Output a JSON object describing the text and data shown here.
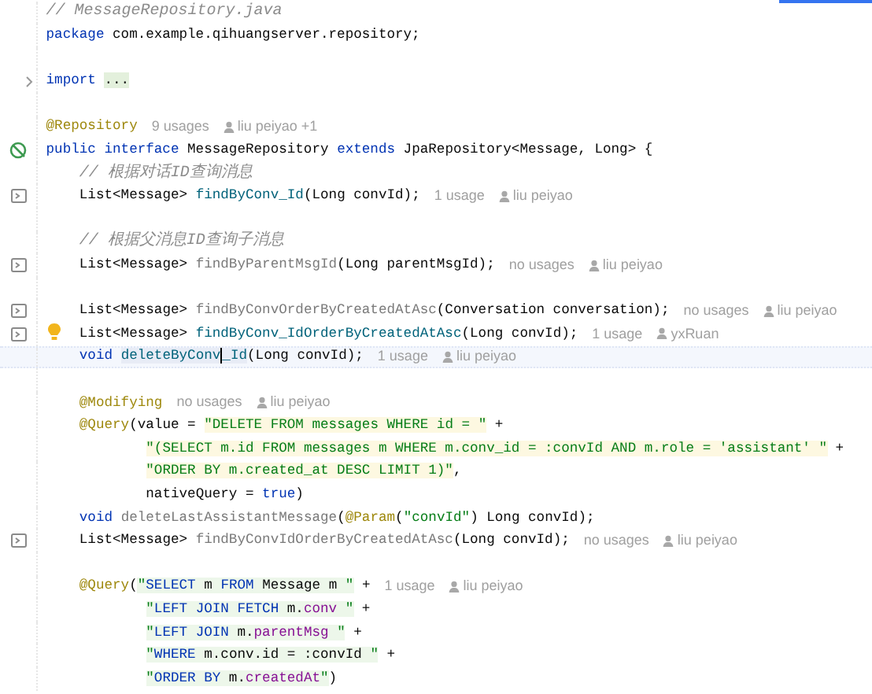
{
  "editor": {
    "lines": [
      {
        "current": false,
        "code": [
          {
            "t": "// MessageRepository.java",
            "kind": "comment"
          }
        ]
      },
      {
        "current": false,
        "code": [
          {
            "t": "package",
            "kind": "kw"
          },
          {
            "t": " com.example.qihuangserver.repository;",
            "kind": "plain"
          }
        ]
      },
      {
        "current": false
      },
      {
        "current": false,
        "gutter": {
          "kind": "fold"
        },
        "code": [
          {
            "t": "import ",
            "kind": "kw"
          },
          {
            "t": "...",
            "kind": "plain",
            "folded": true
          }
        ]
      },
      {
        "current": false
      },
      {
        "current": false,
        "code": [
          {
            "t": "@Repository",
            "kind": "ann"
          }
        ],
        "hints": [
          {
            "kind": "usages",
            "text": "9 usages"
          },
          {
            "kind": "author",
            "text": "liu peiyao +1"
          }
        ]
      },
      {
        "current": false,
        "gutter": {
          "kind": "implemented"
        },
        "code": [
          {
            "t": "public interface",
            "kind": "kw"
          },
          {
            "t": " MessageRepository ",
            "kind": "plain"
          },
          {
            "t": "extends",
            "kind": "kw"
          },
          {
            "t": " JpaRepository<Message, Long> {",
            "kind": "plain"
          }
        ]
      },
      {
        "current": false,
        "code": [
          {
            "t": "    // 根据对话ID查询消息",
            "kind": "comment"
          }
        ]
      },
      {
        "current": false,
        "gutter": {
          "kind": "method"
        },
        "code": [
          {
            "t": "    List<Message> ",
            "kind": "plain"
          },
          {
            "t": "findByConv_Id",
            "kind": "decl"
          },
          {
            "t": "(Long convId);",
            "kind": "plain"
          }
        ],
        "hints": [
          {
            "kind": "usages",
            "text": "1 usage"
          },
          {
            "kind": "author",
            "text": "liu peiyao"
          }
        ]
      },
      {
        "current": false
      },
      {
        "current": false,
        "code": [
          {
            "t": "    // 根据父消息ID查询子消息",
            "kind": "comment"
          }
        ]
      },
      {
        "current": false,
        "gutter": {
          "kind": "method"
        },
        "code": [
          {
            "t": "    List<Message> ",
            "kind": "plain"
          },
          {
            "t": "findByParentMsgId",
            "kind": "unused"
          },
          {
            "t": "(Long parentMsgId);",
            "kind": "plain"
          }
        ],
        "hints": [
          {
            "kind": "usages",
            "text": "no usages"
          },
          {
            "kind": "author",
            "text": "liu peiyao"
          }
        ]
      },
      {
        "current": false
      },
      {
        "current": false,
        "gutter": {
          "kind": "method"
        },
        "code": [
          {
            "t": "    List<Message> ",
            "kind": "plain"
          },
          {
            "t": "findByConvOrderByCreatedAtAsc",
            "kind": "unused"
          },
          {
            "t": "(Conversation conversation);",
            "kind": "plain"
          }
        ],
        "hints": [
          {
            "kind": "usages",
            "text": "no usages"
          },
          {
            "kind": "author",
            "text": "liu peiyao"
          }
        ]
      },
      {
        "current": false,
        "gutter": {
          "kind": "method"
        },
        "bulb": true,
        "code": [
          {
            "t": "    List<Message> ",
            "kind": "plain"
          },
          {
            "t": "findByConv_IdOrderByCreatedAtAsc",
            "kind": "decl"
          },
          {
            "t": "(Long convId);",
            "kind": "plain"
          }
        ],
        "hints": [
          {
            "kind": "usages",
            "text": "1 usage"
          },
          {
            "kind": "author",
            "text": "yxRuan"
          }
        ]
      },
      {
        "current": true,
        "code": [
          {
            "t": "    void ",
            "kind": "kw"
          },
          {
            "t": "deleteByConv",
            "kind": "decl",
            "usage_highlight": true,
            "caret": true
          },
          {
            "t": "_Id",
            "kind": "decl",
            "usage_highlight": true
          },
          {
            "t": "(Long convId);",
            "kind": "plain"
          }
        ],
        "hints": [
          {
            "kind": "usages",
            "text": "1 usage"
          },
          {
            "kind": "author",
            "text": "liu peiyao"
          }
        ]
      },
      {
        "current": false
      },
      {
        "current": false,
        "code": [
          {
            "t": "    @Modifying",
            "kind": "ann"
          }
        ],
        "hints": [
          {
            "kind": "usages",
            "text": "no usages"
          },
          {
            "kind": "author",
            "text": "liu peiyao"
          }
        ]
      },
      {
        "current": false,
        "code": [
          {
            "t": "    @Query",
            "kind": "ann"
          },
          {
            "t": "(value = ",
            "kind": "plain"
          },
          {
            "t": "\"DELETE FROM messages WHERE id = \"",
            "kind": "str",
            "sql": true
          },
          {
            "t": " +",
            "kind": "plain"
          }
        ]
      },
      {
        "current": false,
        "code": [
          {
            "t": "            \"(SELECT m.id FROM messages m WHERE m.conv_id = :convId AND m.role = 'assistant' \"",
            "kind": "str",
            "sql": true
          },
          {
            "t": " +",
            "kind": "plain"
          }
        ]
      },
      {
        "current": false,
        "code": [
          {
            "t": "            \"ORDER BY m.created_at DESC LIMIT 1)\"",
            "kind": "str",
            "sql": true
          },
          {
            "t": ",",
            "kind": "plain"
          }
        ]
      },
      {
        "current": false,
        "code": [
          {
            "t": "            nativeQuery = ",
            "kind": "plain"
          },
          {
            "t": "true",
            "kind": "kw"
          },
          {
            "t": ")",
            "kind": "plain"
          }
        ]
      },
      {
        "current": false,
        "code": [
          {
            "t": "    void ",
            "kind": "kw"
          },
          {
            "t": "deleteLastAssistantMessage",
            "kind": "unused"
          },
          {
            "t": "(",
            "kind": "plain"
          },
          {
            "t": "@Param",
            "kind": "ann"
          },
          {
            "t": "(",
            "kind": "plain"
          },
          {
            "t": "\"convId\"",
            "kind": "str"
          },
          {
            "t": ") Long convId);",
            "kind": "plain"
          }
        ]
      },
      {
        "current": false,
        "gutter": {
          "kind": "method"
        },
        "code": [
          {
            "t": "    List<Message> ",
            "kind": "plain"
          },
          {
            "t": "findByConvIdOrderByCreatedAtAsc",
            "kind": "unused"
          },
          {
            "t": "(Long convId);",
            "kind": "plain"
          }
        ],
        "hints": [
          {
            "kind": "usages",
            "text": "no usages"
          },
          {
            "kind": "author",
            "text": "liu peiyao"
          }
        ]
      },
      {
        "current": false
      },
      {
        "current": false,
        "code": [
          {
            "t": "    @Query",
            "kind": "ann"
          },
          {
            "t": "(",
            "kind": "plain"
          },
          {
            "t": "\"",
            "kind": "str",
            "jpql": true
          },
          {
            "t": "SELECT",
            "kind": "kw",
            "jpql": true
          },
          {
            "t": " m ",
            "kind": "plain",
            "jpql": true
          },
          {
            "t": "FROM",
            "kind": "kw",
            "jpql": true
          },
          {
            "t": " Message m ",
            "kind": "plain",
            "jpql": true
          },
          {
            "t": "\"",
            "kind": "str",
            "jpql": true
          },
          {
            "t": " +",
            "kind": "plain"
          }
        ],
        "hints": [
          {
            "kind": "usages",
            "text": "1 usage"
          },
          {
            "kind": "author",
            "text": "liu peiyao"
          }
        ]
      },
      {
        "current": false,
        "code": [
          {
            "t": "            \"",
            "kind": "str",
            "jpql": true
          },
          {
            "t": "LEFT JOIN FETCH",
            "kind": "kw",
            "jpql": true
          },
          {
            "t": " m.",
            "kind": "plain",
            "jpql": true
          },
          {
            "t": "conv",
            "kind": "field",
            "jpql": true
          },
          {
            "t": " \"",
            "kind": "str",
            "jpql": true
          },
          {
            "t": " +",
            "kind": "plain"
          }
        ]
      },
      {
        "current": false,
        "code": [
          {
            "t": "            \"",
            "kind": "str",
            "jpql": true
          },
          {
            "t": "LEFT JOIN",
            "kind": "kw",
            "jpql": true
          },
          {
            "t": " m.",
            "kind": "plain",
            "jpql": true
          },
          {
            "t": "parentMsg",
            "kind": "field",
            "jpql": true
          },
          {
            "t": " \"",
            "kind": "str",
            "jpql": true
          },
          {
            "t": " +",
            "kind": "plain"
          }
        ]
      },
      {
        "current": false,
        "code": [
          {
            "t": "            \"",
            "kind": "str",
            "jpql": true
          },
          {
            "t": "WHERE",
            "kind": "kw",
            "jpql": true
          },
          {
            "t": " m.conv.id = :convId ",
            "kind": "plain",
            "jpql": true
          },
          {
            "t": "\"",
            "kind": "str",
            "jpql": true
          },
          {
            "t": " +",
            "kind": "plain"
          }
        ]
      },
      {
        "current": false,
        "code": [
          {
            "t": "            \"",
            "kind": "str",
            "jpql": true
          },
          {
            "t": "ORDER BY",
            "kind": "kw",
            "jpql": true
          },
          {
            "t": " m.",
            "kind": "plain",
            "jpql": true
          },
          {
            "t": "createdAt",
            "kind": "field",
            "jpql": true
          },
          {
            "t": "\"",
            "kind": "str",
            "jpql": true
          },
          {
            "t": ")",
            "kind": "plain"
          }
        ]
      }
    ]
  }
}
